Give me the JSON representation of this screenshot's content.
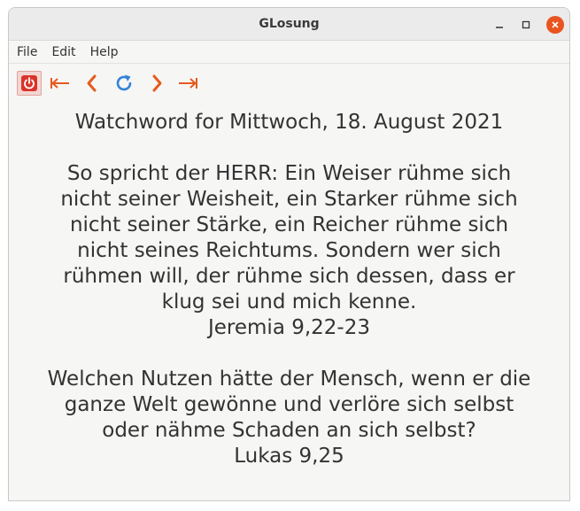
{
  "window": {
    "title": "GLosung"
  },
  "menubar": {
    "items": [
      "File",
      "Edit",
      "Help"
    ]
  },
  "toolbar": {
    "buttons": [
      {
        "name": "power-icon",
        "color": "#d9332a"
      },
      {
        "name": "first-icon",
        "color": "#e65a1e"
      },
      {
        "name": "prev-icon",
        "color": "#e65a1e"
      },
      {
        "name": "reload-icon",
        "color": "#3383d6"
      },
      {
        "name": "next-icon",
        "color": "#e65a1e"
      },
      {
        "name": "last-icon",
        "color": "#e65a1e"
      }
    ]
  },
  "content": {
    "heading": "Watchword for Mittwoch, 18. August 2021",
    "watchword": {
      "lines": [
        "So spricht der HERR: Ein Weiser rühme sich",
        "nicht seiner Weisheit, ein Starker rühme sich",
        "nicht seiner Stärke, ein Reicher rühme sich",
        "nicht seines Reichtums. Sondern wer sich",
        "rühmen will, der rühme sich dessen, dass er",
        "klug sei und mich kenne."
      ],
      "source": "Jeremia 9,22-23"
    },
    "teaching": {
      "lines": [
        "Welchen Nutzen hätte der Mensch, wenn er die",
        "ganze Welt gewönne und verlöre sich selbst",
        "oder nähme Schaden an sich selbst?"
      ],
      "source": "Lukas 9,25"
    }
  }
}
